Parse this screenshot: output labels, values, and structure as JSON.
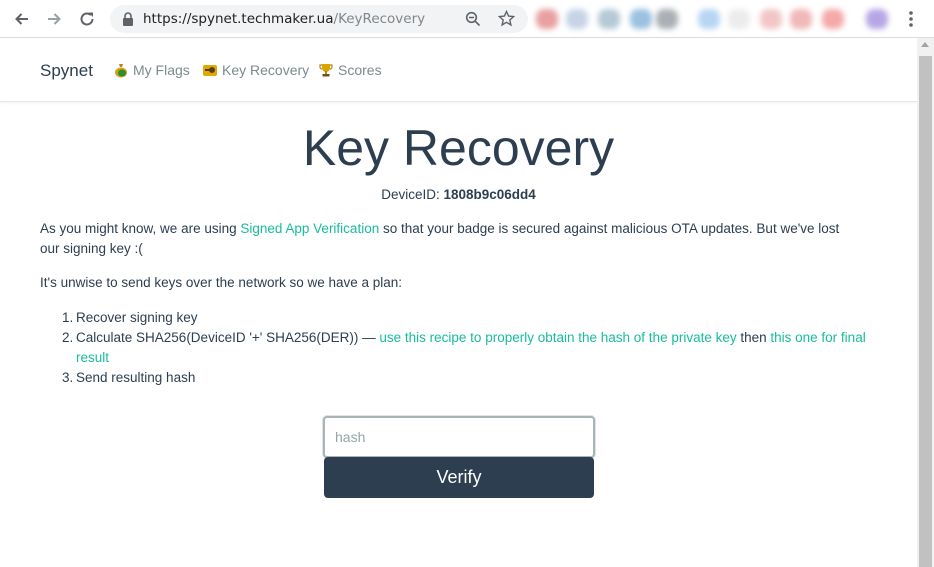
{
  "browser": {
    "url_host": "https://spynet.techmaker.ua",
    "url_path": "/KeyRecovery",
    "icons": [
      "back-icon",
      "forward-icon",
      "reload-icon",
      "lock-icon",
      "zoom-icon",
      "star-icon",
      "menu-icon"
    ]
  },
  "nav": {
    "brand": "Spynet",
    "items": [
      {
        "label": "My Flags",
        "icon": "money-bag-icon"
      },
      {
        "label": "Key Recovery",
        "icon": "key-icon"
      },
      {
        "label": "Scores",
        "icon": "trophy-icon"
      }
    ]
  },
  "main": {
    "title": "Key Recovery",
    "device_label": "DeviceID:",
    "device_id": "1808b9c06dd4",
    "intro_pre": "As you might know, we are using ",
    "intro_link": "Signed App Verification",
    "intro_post": " so that your badge is secured against malicious OTA updates. But we've lost our signing key :(",
    "plan": "It's unwise to send keys over the network so we have a plan:",
    "steps": {
      "s1_num": "1.",
      "s1": "Recover signing key",
      "s2_num": "2.",
      "s2_pre": "Calculate SHA256(DeviceID '+' SHA256(DER)) — ",
      "s2_link1": "use this recipe to properly obtain the hash of the private key",
      "s2_mid": " then ",
      "s2_link2": "this one for final result",
      "s3_num": "3.",
      "s3": "Send resulting hash"
    },
    "hash_placeholder": "hash",
    "hash_value": "",
    "verify_label": "Verify"
  },
  "colors": {
    "primary": "#2c3e50",
    "link": "#18bc9c",
    "muted": "#7b8a8b"
  }
}
